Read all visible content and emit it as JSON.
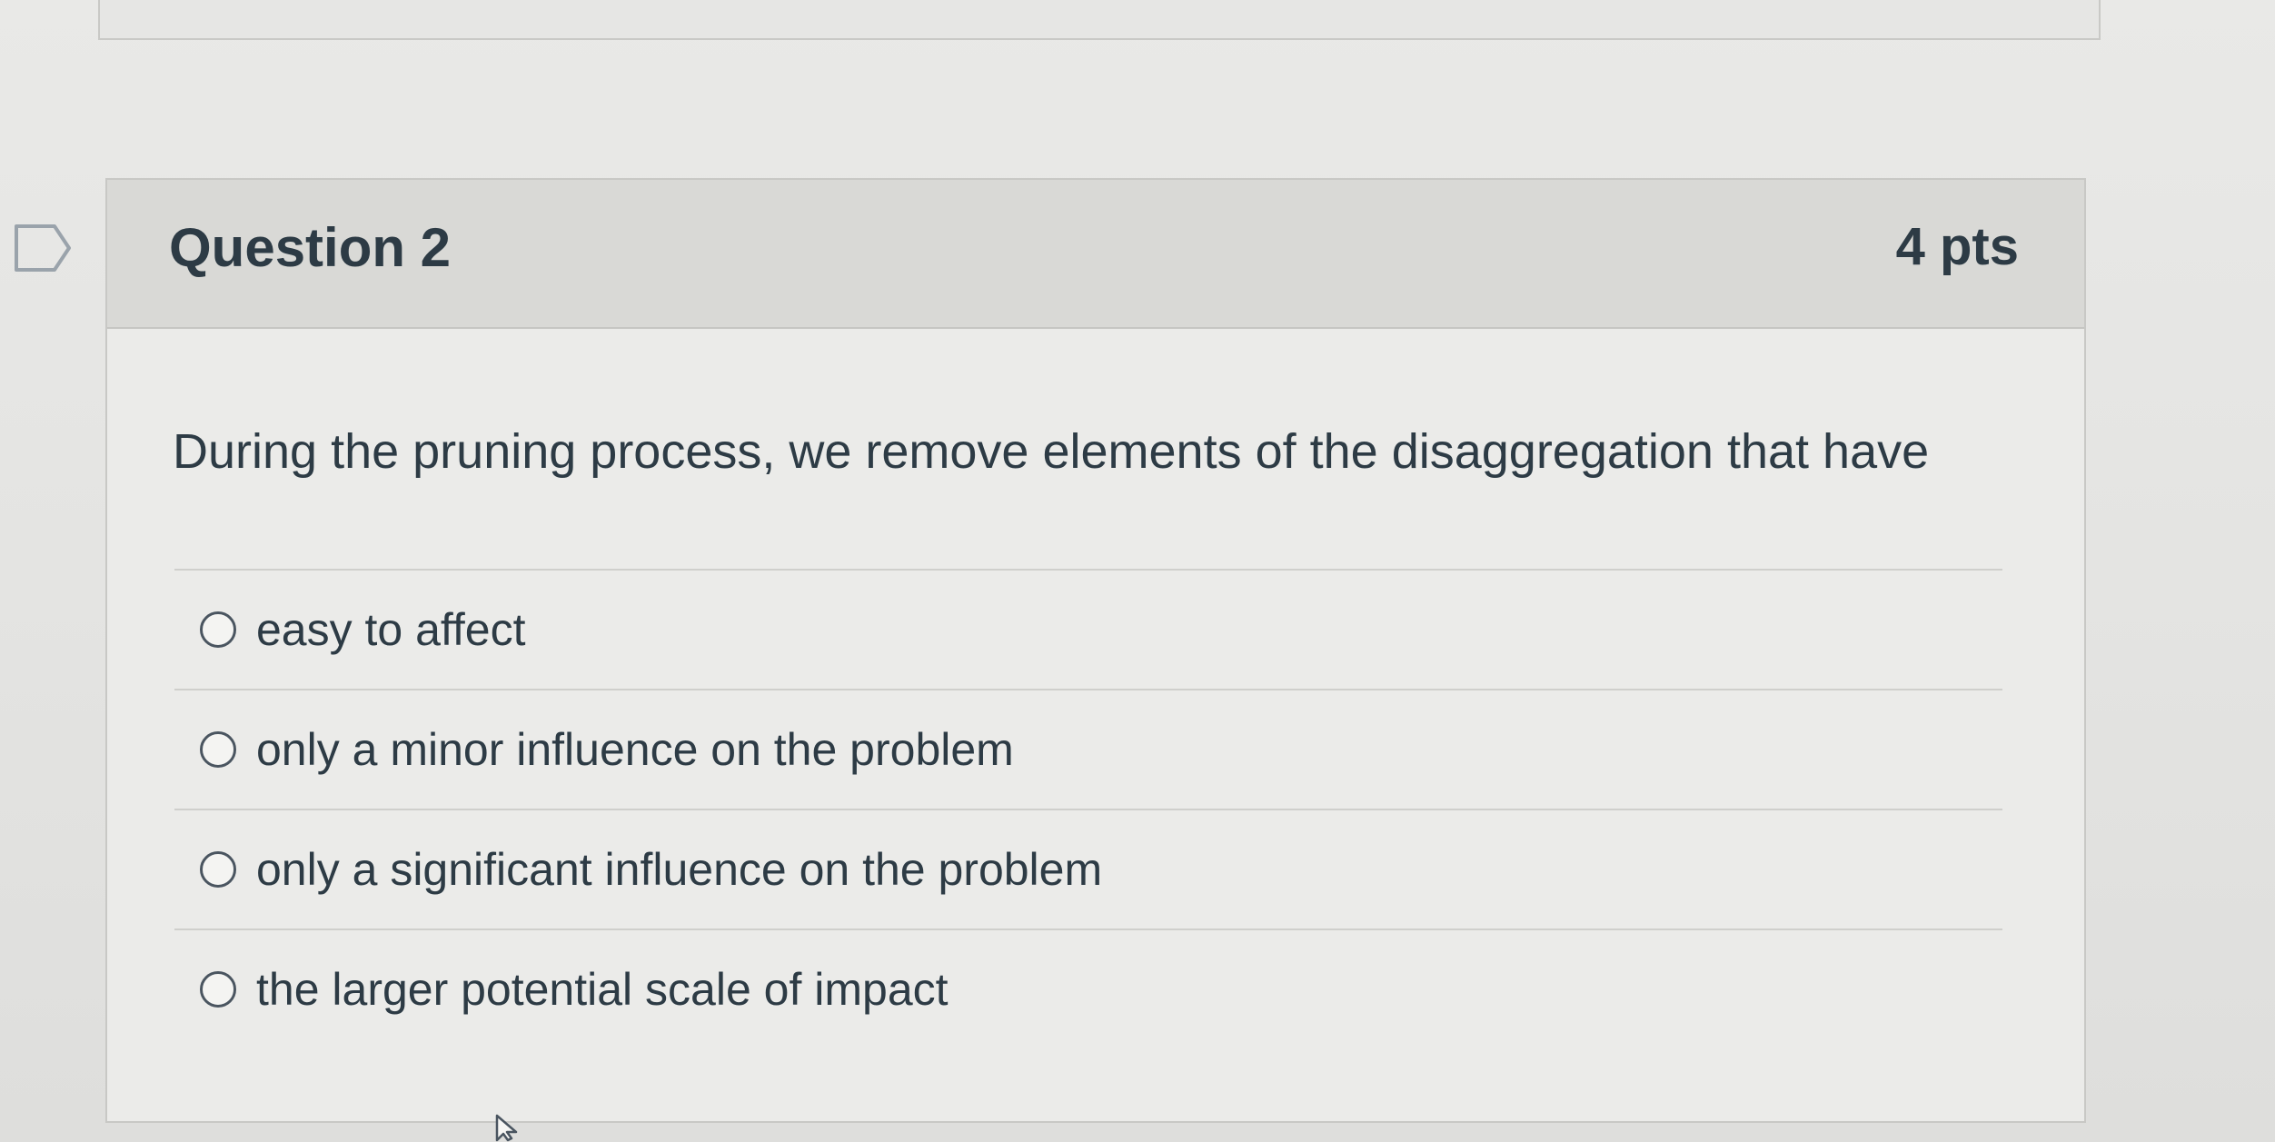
{
  "question": {
    "title": "Question 2",
    "points": "4 pts",
    "text": "During the pruning process, we remove elements of the disaggregation that have",
    "answers": [
      {
        "label": "easy to affect",
        "selected": false
      },
      {
        "label": "only a minor influence on the problem",
        "selected": false
      },
      {
        "label": "only a significant influence on the problem",
        "selected": false
      },
      {
        "label": "the larger potential scale of impact",
        "selected": false
      }
    ]
  },
  "icons": {
    "flag": "bookmark-flag-icon",
    "radio": "radio-button-icon",
    "cursor": "mouse-pointer-icon"
  },
  "colors": {
    "text": "#2d3b45",
    "header_bg": "#d9d9d6",
    "card_bg": "#ebebe9",
    "border": "#c8c8c5"
  }
}
